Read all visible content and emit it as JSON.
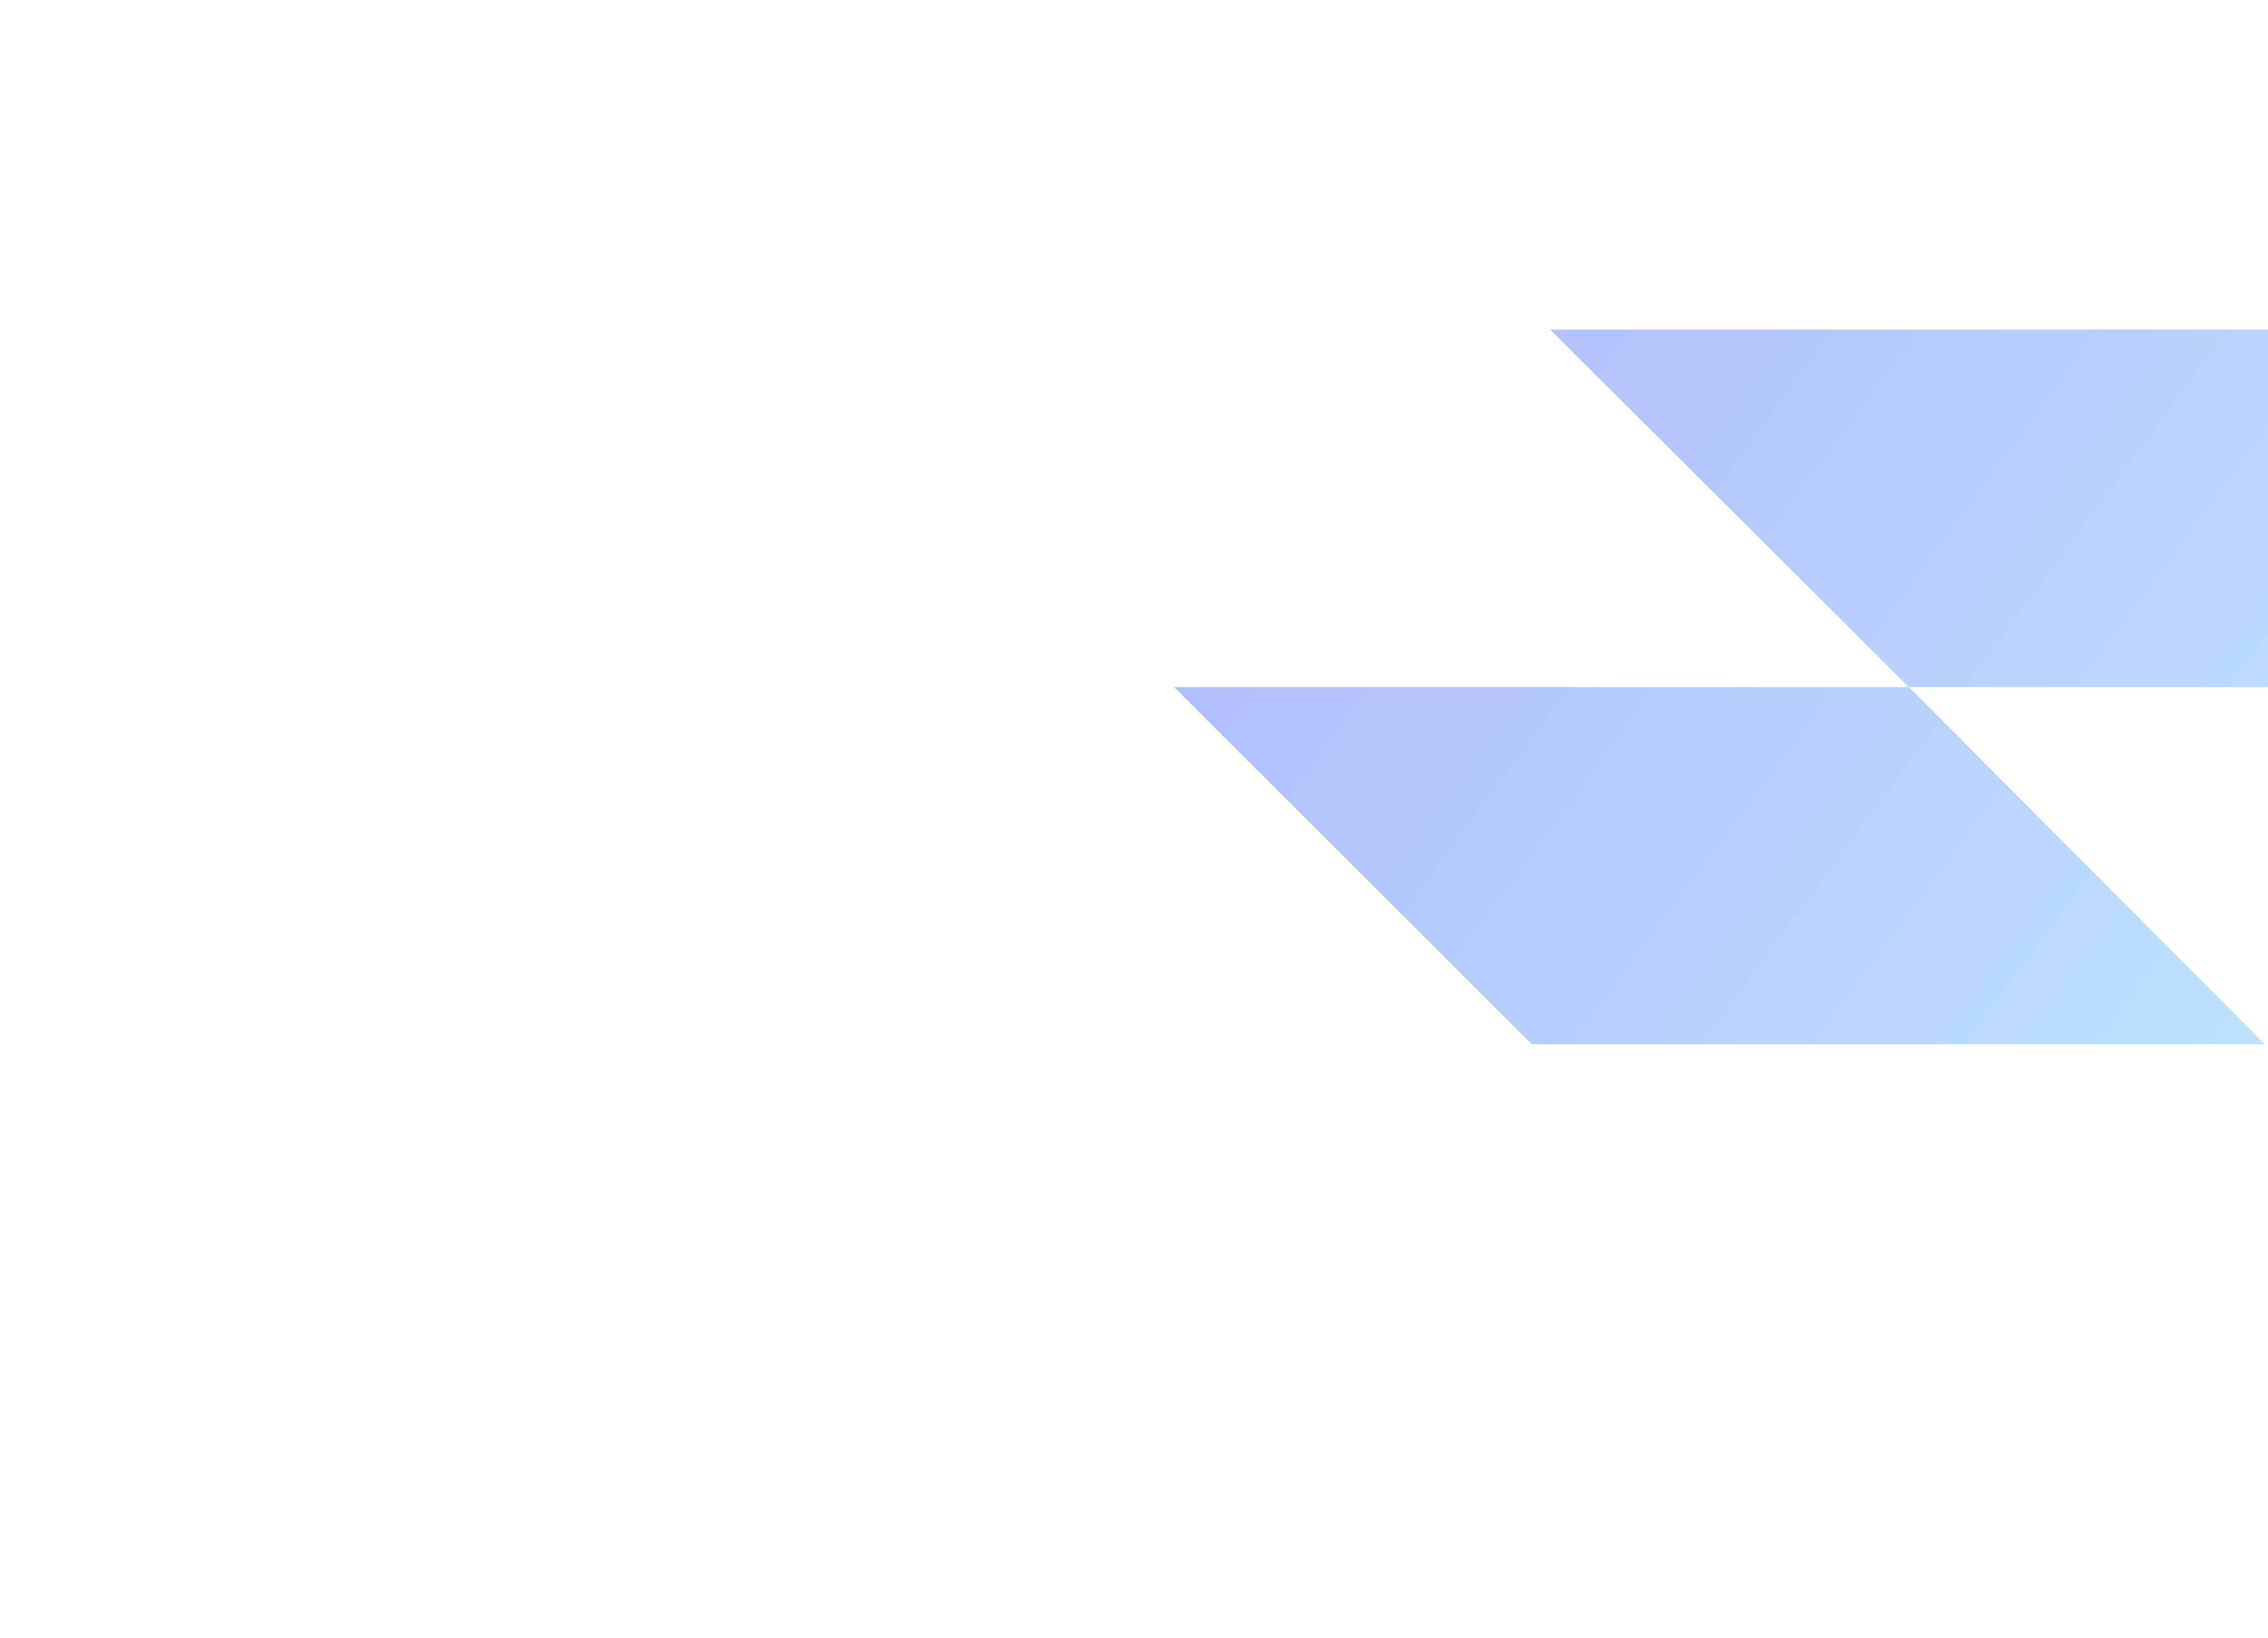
{
  "colors": {
    "background": "#ffffff",
    "gradient_start": "#b1bbfd",
    "gradient_end": "#bde1fe"
  }
}
